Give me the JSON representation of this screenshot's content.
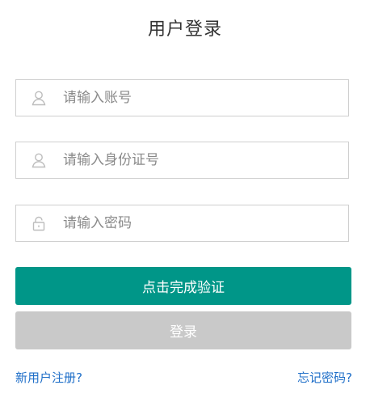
{
  "title": "用户登录",
  "fields": {
    "account": {
      "placeholder": "请输入账号",
      "value": "",
      "icon": "user-icon"
    },
    "id_number": {
      "placeholder": "请输入身份证号",
      "value": "",
      "icon": "user-icon"
    },
    "password": {
      "placeholder": "请输入密码",
      "value": "",
      "icon": "lock-icon"
    }
  },
  "buttons": {
    "verify_label": "点击完成验证",
    "login_label": "登录"
  },
  "links": {
    "register": "新用户注册?",
    "forgot": "忘记密码?"
  },
  "colors": {
    "primary": "#009688",
    "disabled": "#c9c9c9",
    "link": "#1e6ec8",
    "border": "#cfcfcf"
  }
}
